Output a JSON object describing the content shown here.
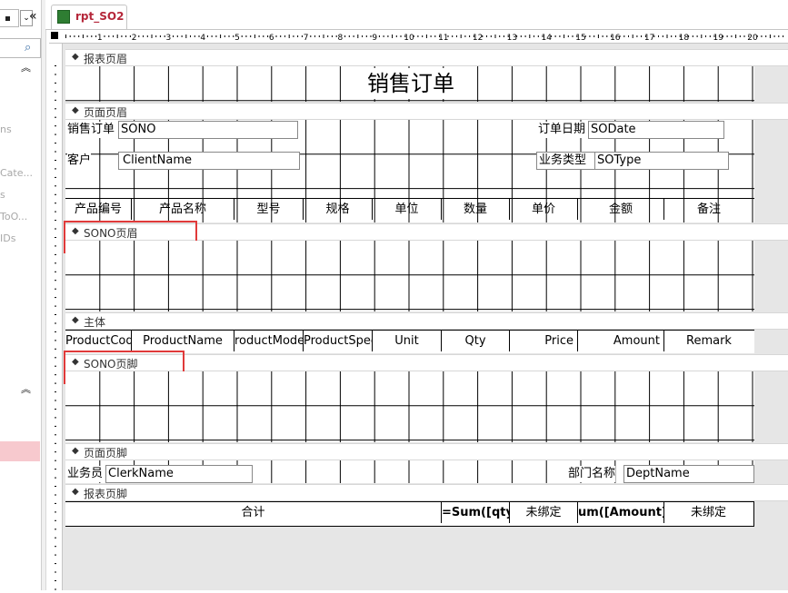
{
  "nav": {
    "collapse_glyph": "«",
    "items": [
      "ns",
      "Cate...",
      "s",
      "ToO...",
      "IDs"
    ]
  },
  "tab": {
    "label": "rpt_SO2"
  },
  "ruler": {
    "marks": [
      "1",
      "2",
      "3",
      "4",
      "5",
      "6",
      "7",
      "8",
      "9",
      "10",
      "11",
      "12",
      "13",
      "14",
      "15",
      "16",
      "17",
      "18",
      "19",
      "20"
    ]
  },
  "sections": {
    "report_header": "报表页眉",
    "page_header": "页面页眉",
    "sono_header": "SONO页眉",
    "detail": "主体",
    "sono_footer": "SONO页脚",
    "page_footer": "页面页脚",
    "report_footer": "报表页脚"
  },
  "report_header": {
    "title": "销售订单"
  },
  "page_header": {
    "so_label": "销售订单",
    "so_field": "SONO",
    "date_label": "订单日期",
    "date_field": "SODate",
    "client_label": "客户",
    "client_field": "ClientName",
    "type_label": "业务类型",
    "type_field": "SOType",
    "columns": [
      "产品编号",
      "产品名称",
      "型号",
      "规格",
      "单位",
      "数量",
      "单价",
      "金额",
      "备注"
    ]
  },
  "detail": {
    "fields": [
      "ProductCod",
      "ProductName",
      "roductMode",
      "ProductSpec",
      "Unit",
      "Qty",
      "Price",
      "Amount",
      "Remark"
    ]
  },
  "page_footer": {
    "clerk_label": "业务员",
    "clerk_field": "ClerkName",
    "dept_label": "部门名称",
    "dept_field": "DeptName"
  },
  "report_footer": {
    "total_label": "合计",
    "sum_qty": "=Sum([qty])",
    "unbound1": "未绑定",
    "sum_amount": "um([Amount])",
    "unbound2": "未绑定"
  },
  "colors": {
    "highlight": "#e03a3a",
    "tab_text": "#b5273a",
    "nav_selected": "#f7c9ce"
  }
}
